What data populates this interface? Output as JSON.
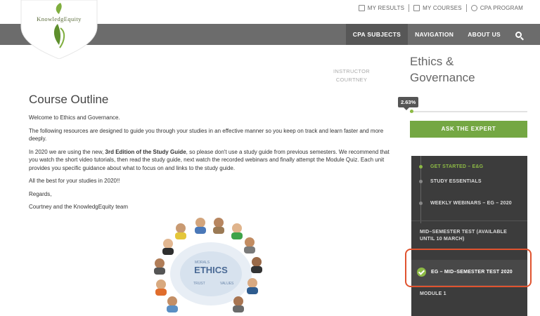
{
  "logo": {
    "text": "KnowledgEquity"
  },
  "top_links": [
    {
      "label": "MY RESULTS",
      "icon": "results-icon"
    },
    {
      "label": "MY COURSES",
      "icon": "courses-icon"
    },
    {
      "label": "CPA PROGRAM",
      "icon": "cpa-icon"
    }
  ],
  "nav": {
    "items": [
      "CPA SUBJECTS",
      "NAVIGATION",
      "ABOUT US"
    ],
    "active": "CPA SUBJECTS",
    "search_icon": "search-icon"
  },
  "instructor": {
    "line1": "INSTRUCTOR",
    "line2": "COURTNEY"
  },
  "main": {
    "title": "Course Outline",
    "welcome": "Welcome to Ethics and Governance.",
    "para1": "The following resources are designed to guide you through your studies in an effective manner so you keep on track and learn faster and more deeply.",
    "para2_pre": "In 2020 we are using the new, ",
    "para2_bold": "3rd Edition of the Study Guide",
    "para2_post": ", so please don't use a study guide from previous semesters. We recommend that you watch the short video tutorials, then read the study guide, next watch the recorded webinars and finally attempt the Module Quiz. Each unit provides you specific guidance about what to focus on and links to the study guide.",
    "para3": "All the best for your studies in 2020!!",
    "regards": "Regards,",
    "signoff": "Courtney and the KnowledgEquity team",
    "illustration_text": "ETHICS"
  },
  "sidebar": {
    "title_line1": "Ethics &",
    "title_line2": "Governance",
    "progress_label": "2.63%",
    "progress_value": 0.0263,
    "ask_button": "ASK THE EXPERT",
    "menu": {
      "items": [
        {
          "label": "GET STARTED – E&G",
          "state": "active"
        },
        {
          "label": "STUDY ESSENTIALS",
          "state": "normal"
        },
        {
          "label": "WEEKLY WEBINARS – EG – 2020",
          "state": "normal"
        }
      ],
      "section_header_line1": "MID–SEMESTER TEST (AVAILABLE",
      "section_header_line2": "UNTIL 10 MARCH)",
      "test_item": "EG – MID–SEMESTER TEST 2020",
      "module": "MODULE 1"
    }
  },
  "colors": {
    "nav_bg": "#6c6c6c",
    "accent_green": "#74a743",
    "menu_bg": "#3c3c3c",
    "highlight": "#e0532f"
  }
}
